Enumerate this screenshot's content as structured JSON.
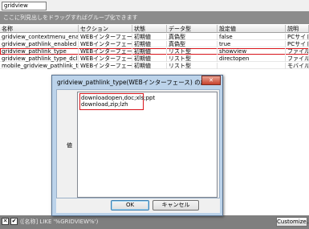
{
  "filter": {
    "value": "gridview"
  },
  "group_panel": {
    "hint": "ここに列見出しをドラッグすればグループ化できます"
  },
  "grid": {
    "columns": [
      "名称",
      "セクション",
      "状態",
      "データ型",
      "設定値",
      "説明"
    ],
    "rows": [
      [
        "gridview_contextmenu_enabled",
        "WEBインターフェース",
        "初期値",
        "真偽型",
        "false",
        "PCサイト"
      ],
      [
        "gridview_pathlink_enabled",
        "WEBインターフェース",
        "初期値",
        "真偽型",
        "true",
        "PCサイト"
      ],
      [
        "gridview_pathlink_type",
        "WEBインターフェース",
        "初期値",
        "リスト型",
        "showview",
        "ファイル一"
      ],
      [
        "gridview_pathlink_type_dclick",
        "WEBインターフェース",
        "初期値",
        "リスト型",
        "directopen",
        "ファイル一"
      ],
      [
        "mobile_gridview_pathlink_type",
        "WEBインターフェース",
        "初期値",
        "リスト型",
        "",
        "モバイルペ"
      ]
    ],
    "selected_row": 2
  },
  "bottom_bar": {
    "close_symbol": "✕",
    "check_symbol": "✔",
    "filter_text": "([名称] LIKE '%GRIDVIEW%')",
    "customize_label": "Customize..."
  },
  "dialog": {
    "title": "gridview_pathlink_type(WEBインターフェース) の設定",
    "close_symbol": "✕",
    "field_label": "値",
    "value": "downloadopen,doc;xls;ppt\ndownload,zip;lzh",
    "ok_label": "OK",
    "cancel_label": "キャンセル"
  }
}
